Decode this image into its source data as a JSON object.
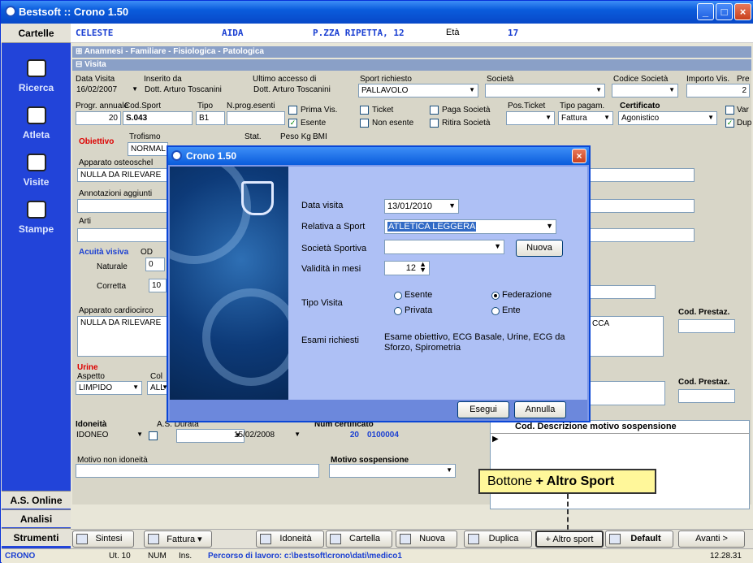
{
  "window": {
    "title": "Bestsoft :: Crono 1.50"
  },
  "sidebar": {
    "header": "Cartelle",
    "items": [
      {
        "label": "Ricerca",
        "icon": "people-icon"
      },
      {
        "label": "Atleta",
        "icon": "person-icon"
      },
      {
        "label": "Visite",
        "icon": "doctor-icon"
      },
      {
        "label": "Stampe",
        "icon": "print-icon"
      }
    ],
    "bottom": [
      "A.S. Online",
      "Analisi",
      "Strumenti"
    ]
  },
  "patient": {
    "surname": "CELESTE",
    "name": "AIDA",
    "address": "P.ZZA RIPETTA, 12",
    "age_label": "Età",
    "age": "17"
  },
  "sections": {
    "anamnesi": "⊞ Anamnesi - Familiare - Fisiologica - Patologica",
    "visita": "⊟ Visita"
  },
  "visita": {
    "data_visita_label": "Data Visita",
    "data_visita": "16/02/2007",
    "inserito_label": "Inserito da",
    "inserito": "Dott. Arturo Toscanini",
    "ultimo_label": "Ultimo accesso di",
    "ultimo": "Dott. Arturo Toscanini",
    "sport_label": "Sport richiesto",
    "sport": "PALLAVOLO",
    "societa_label": "Società",
    "codice_societa_label": "Codice Società",
    "importo_label": "Importo Vis.",
    "importo_cut": "Pre",
    "importo_value": "2",
    "progr_label": "Progr. annuale",
    "progr": "20",
    "codsport_label": "Cod.Sport",
    "codsport": "S.043",
    "tipo_label": "Tipo",
    "tipo": "B1",
    "nprog_label": "N.prog.esenti",
    "prima_vis": "Prima Vis.",
    "esente": "Esente",
    "ticket": "Ticket",
    "non_esente": "Non esente",
    "paga_societa": "Paga Società",
    "ritira_societa": "Ritira Società",
    "pos_ticket_label": "Pos.Ticket",
    "tipo_pagam_label": "Tipo pagam.",
    "tipo_pagam": "Fattura",
    "certificato_label": "Certificato",
    "certificato": "Agonistico",
    "var_label": "Var",
    "dup_label": "Dup"
  },
  "obiettivo": {
    "label": "Obiettivo",
    "trofismo_label": "Trofismo",
    "trofismo": "NORMAL",
    "stat_label": "Stat.",
    "peso_label": "Peso Kg",
    "bmi_label": "BMI",
    "osteo_label": "Apparato osteoschel",
    "osteo": "NULLA DA RILEVARE",
    "annot_label": "Annotazioni aggiunti",
    "arti_label": "Arti",
    "acuita_label": "Acuità visiva",
    "od_label": "OD",
    "naturale_label": "Naturale",
    "naturale": "0",
    "corretta_label": "Corretta",
    "corretta": "10",
    "cardio_label": "Apparato cardiocirco",
    "cardio": "NULLA DA RILEVARE",
    "cca": "CCA",
    "cod_prestaz": "Cod. Prestaz."
  },
  "urine": {
    "label": "Urine",
    "aspetto_label": "Aspetto",
    "aspetto": "LIMPIDO",
    "colore_label": "Col",
    "colore": "ALL",
    "cod_prestaz": "Cod. Prestaz."
  },
  "idoneita": {
    "label": "Idoneità",
    "value": "IDONEO",
    "durata_label": "A.S. Durata",
    "scadenza": "15/02/2008",
    "num_cert_label": "Num certificato",
    "progr": "20",
    "num_cert": "0100004",
    "motivo_non_label": "Motivo non idoneità",
    "motivo_sosp_label": "Motivo sospensione",
    "grid_header": "Cod. Descrizione motivo sospensione"
  },
  "dialog": {
    "title": "Crono 1.50",
    "data_visita_label": "Data visita",
    "data_visita": "13/01/2010",
    "sport_label": "Relativa a Sport",
    "sport": "ATLETICA LEGGERA",
    "societa_label": "Società Sportiva",
    "nuova_button": "Nuova",
    "validita_label": "Validità in mesi",
    "validita": "12",
    "tipo_label": "Tipo Visita",
    "options": {
      "esente": "Esente",
      "federazione": "Federazione",
      "privata": "Privata",
      "ente": "Ente"
    },
    "esami_label": "Esami richiesti",
    "esami": "Esame obiettivo, ECG Basale, Urine, ECG da Sforzo, Spirometria",
    "esegui": "Esegui",
    "annulla": "Annulla"
  },
  "toolbar": {
    "sintesi": "Sintesi",
    "fattura": "Fattura ▾",
    "idoneita": "Idoneità",
    "cartella": "Cartella",
    "nuova": "Nuova",
    "duplica": "Duplica",
    "altro_sport": "+ Altro sport",
    "default": "Default",
    "avanti": "Avanti >"
  },
  "callout": {
    "prefix": "Bottone",
    "bold": "+ Altro Sport"
  },
  "status": {
    "app": "CRONO",
    "ut": "Ut. 10",
    "num": "NUM",
    "ins": "Ins.",
    "path": "Percorso di lavoro: c:\\bestsoft\\crono\\dati\\medico1",
    "time": "12.28.31"
  }
}
